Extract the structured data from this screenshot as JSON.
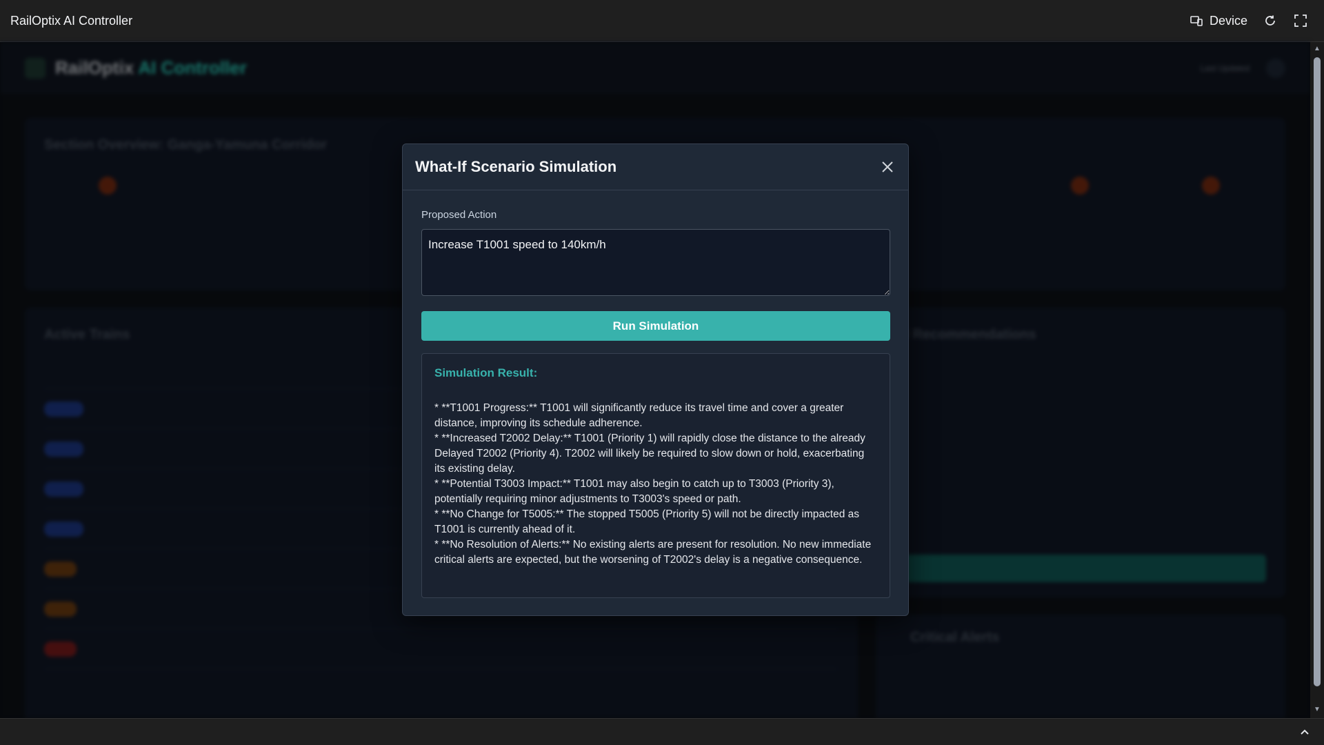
{
  "browser": {
    "title": "RailOptix AI Controller",
    "device_label": "Device"
  },
  "app": {
    "brand_main": "RailOptix",
    "brand_accent": "AI Controller",
    "last_updated_label": "Last Updated",
    "section_title": "Section Overview: Ganga-Yamuna Corridor",
    "trains_title": "Active Trains",
    "reco_title": "AI Recommendations",
    "alerts_title": "Critical Alerts",
    "accent_color": "#2dd4bf"
  },
  "modal": {
    "title": "What-If Scenario Simulation",
    "proposed_action_label": "Proposed Action",
    "proposed_action_value": "Increase T1001 speed to 140km/h",
    "run_button_label": "Run Simulation",
    "result_title": "Simulation Result:",
    "result_lines": [
      "*   **T1001 Progress:** T1001 will significantly reduce its travel time and cover a greater distance, improving its schedule adherence.",
      "*   **Increased T2002 Delay:** T1001 (Priority 1) will rapidly close the distance to the already Delayed T2002 (Priority 4). T2002 will likely be required to slow down or hold, exacerbating its existing delay.",
      "*   **Potential T3003 Impact:** T1001 may also begin to catch up to T3003 (Priority 3), potentially requiring minor adjustments to T3003's speed or path.",
      "*   **No Change for T5005:** The stopped T5005 (Priority 5) will not be directly impacted as T1001 is currently ahead of it.",
      "*   **No Resolution of Alerts:** No existing alerts are present for resolution. No new immediate critical alerts are expected, but the worsening of T2002's delay is a negative consequence."
    ],
    "accent_color": "#38b2ac"
  }
}
